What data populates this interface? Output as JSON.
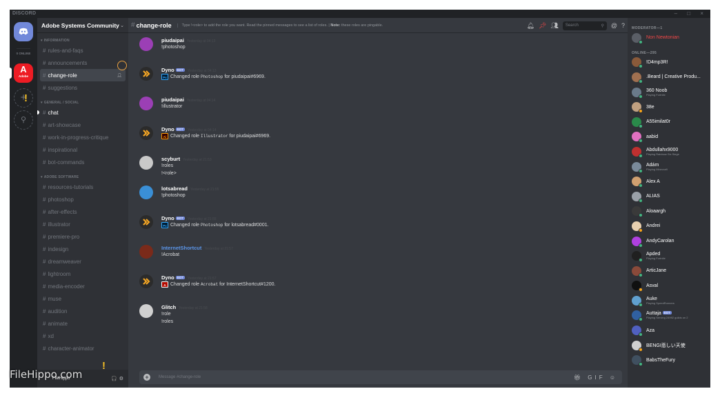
{
  "app": {
    "brand": "DISCORD",
    "window_controls": "– □ ×"
  },
  "guilds": {
    "online": "0 ONLINE",
    "adobe_logo": "A",
    "adobe_text": "Adobe",
    "add": "+",
    "search": "⚲"
  },
  "server": {
    "name": "Adobe Systems Community"
  },
  "categories": [
    {
      "label": "INFORMATION",
      "channels": [
        {
          "name": "rules-and-faqs",
          "state": "muted"
        },
        {
          "name": "announcements",
          "state": "muted"
        },
        {
          "name": "change-role",
          "state": "active"
        },
        {
          "name": "suggestions",
          "state": "muted"
        }
      ]
    },
    {
      "label": "GENERAL / SOCIAL",
      "channels": [
        {
          "name": "chat",
          "state": "unread"
        },
        {
          "name": "art-showcase",
          "state": "muted"
        },
        {
          "name": "work-in-progress-critique",
          "state": "muted"
        },
        {
          "name": "inspirational",
          "state": "muted"
        },
        {
          "name": "bot-commands",
          "state": "muted"
        }
      ]
    },
    {
      "label": "ADOBE SOFTWARE",
      "channels": [
        {
          "name": "resources-tutorials",
          "state": "muted"
        },
        {
          "name": "photoshop",
          "state": "muted"
        },
        {
          "name": "after-effects",
          "state": "muted"
        },
        {
          "name": "illustrator",
          "state": "muted"
        },
        {
          "name": "premiere-pro",
          "state": "muted"
        },
        {
          "name": "indesign",
          "state": "muted"
        },
        {
          "name": "dreamweaver",
          "state": "muted"
        },
        {
          "name": "lightroom",
          "state": "muted"
        },
        {
          "name": "media-encoder",
          "state": "muted"
        },
        {
          "name": "muse",
          "state": "muted"
        },
        {
          "name": "audition",
          "state": "muted"
        },
        {
          "name": "animate",
          "state": "muted"
        },
        {
          "name": "xd",
          "state": "muted"
        },
        {
          "name": "character-animator",
          "state": "muted"
        }
      ]
    }
  ],
  "userbar": {
    "name": "FileHippo"
  },
  "watermark": "FileHippo.com",
  "channel": {
    "name": "change-role",
    "topic_prefix": "Type !<role> to add the role you want. Read the pinned messages to see a list of roles. | ",
    "topic_note_label": "Note:",
    "topic_note": " these roles are pingable.",
    "search_placeholder": "Search"
  },
  "messages": [
    {
      "author": "piudaipai",
      "bot": false,
      "timestamp": "Yesterday at 04:13",
      "lines": [
        "!photoshop"
      ],
      "avatar_color": "#9b3fb5"
    },
    {
      "author": "Dyno",
      "bot": true,
      "timestamp": "Yesterday at 04:13",
      "app_icon": "Ps",
      "app_color": "#001e36",
      "app_fg": "#31a8ff",
      "pre": "Changed role ",
      "code": "Photoshop",
      "post": " for piudaipai#6969.",
      "avatar_color": "#f5a623"
    },
    {
      "author": "piudaipai",
      "bot": false,
      "timestamp": "Yesterday at 04:14",
      "lines": [
        "!illustrator"
      ],
      "avatar_color": "#9b3fb5"
    },
    {
      "author": "Dyno",
      "bot": true,
      "timestamp": "Yesterday at 04:14",
      "app_icon": "Ai",
      "app_color": "#330000",
      "app_fg": "#ff9a00",
      "pre": "Changed role ",
      "code": "Illustrator",
      "post": " for piudaipai#6969.",
      "avatar_color": "#f5a623"
    },
    {
      "author": "scyburt",
      "bot": false,
      "timestamp": "Yesterday at 21:53",
      "lines": [
        "!roles",
        "!<role>"
      ],
      "avatar_color": "#c9c9c9"
    },
    {
      "author": "lotsabread",
      "bot": false,
      "timestamp": "Yesterday at 21:55",
      "lines": [
        "!photoshop"
      ],
      "avatar_color": "#3a8fd6"
    },
    {
      "author": "Dyno",
      "bot": true,
      "timestamp": "Yesterday at 21:55",
      "app_icon": "Ps",
      "app_color": "#001e36",
      "app_fg": "#31a8ff",
      "pre": "Changed role ",
      "code": "Photoshop",
      "post": " for lotsabread#0001.",
      "avatar_color": "#f5a623"
    },
    {
      "author": "InternetShortcut",
      "bot": false,
      "blue": true,
      "timestamp": "Yesterday at 21:57",
      "lines": [
        "!Acrobat"
      ],
      "avatar_color": "#7a2a1a"
    },
    {
      "author": "Dyno",
      "bot": true,
      "timestamp": "Yesterday at 21:57",
      "app_icon": "A",
      "app_color": "#b30b00",
      "app_fg": "#ffffff",
      "pre": "Changed role ",
      "code": "Acrobat",
      "post": " for InternetShortcut#1200.",
      "avatar_color": "#f5a623"
    },
    {
      "author": "Glitch",
      "bot": false,
      "timestamp": "Yesterday at 21:58",
      "lines": [
        "!role",
        "!roles"
      ],
      "avatar_color": "#d0d0d0"
    }
  ],
  "composer": {
    "placeholder": "Message #change-role"
  },
  "members": {
    "moderator_label": "MODERATOR—1",
    "moderators": [
      {
        "name": "Non Newtonian",
        "color": "red",
        "avatar": "#5a5e66",
        "status": "#43b581"
      }
    ],
    "online_label": "ONLINE—295",
    "online": [
      {
        "name": "!D4mp3R!",
        "avatar": "#8a5a3a",
        "status": "#43b581"
      },
      {
        "name": ".Beard | Creative Produ...",
        "avatar": "#a07050",
        "status": "#43b581"
      },
      {
        "name": "360 Noob",
        "activity": "Playing Fortnite",
        "avatar": "#6a7a8a",
        "status": "#43b581"
      },
      {
        "name": "38e",
        "avatar": "#c0a080",
        "status": "#faa61a"
      },
      {
        "name": "A55imilat0r",
        "avatar": "#2a8a4a",
        "status": "#43b581"
      },
      {
        "name": "aabid",
        "avatar": "#e070c0",
        "status": "#43b581"
      },
      {
        "name": "Abdullahx9000",
        "activity": "Playing Rainbow Six Siege",
        "avatar": "#c03030",
        "status": "#43b581"
      },
      {
        "name": "Adám",
        "activity": "Playing Minecraft",
        "avatar": "#7a8a9a",
        "status": "#43b581"
      },
      {
        "name": "Alex A",
        "avatar": "#d0a070",
        "status": "#43b581"
      },
      {
        "name": "ALIAS",
        "avatar": "#9aa0a8",
        "status": "#43b581"
      },
      {
        "name": "Aloaargh",
        "avatar": "#3a3a3a",
        "status": "#43b581"
      },
      {
        "name": "Andrei",
        "avatar": "#e8d0b0",
        "status": "#faa61a"
      },
      {
        "name": "AndyCarolan",
        "avatar": "#b040e0",
        "status": "#43b581"
      },
      {
        "name": "Apded",
        "activity": "Playing Fortnite",
        "avatar": "#202020",
        "status": "#43b581"
      },
      {
        "name": "ArticJane",
        "avatar": "#8a4a3a",
        "status": "#43b581"
      },
      {
        "name": "Asval",
        "avatar": "#101010",
        "status": "#faa61a"
      },
      {
        "name": "Auke",
        "activity": "Playing SpeedRunners",
        "avatar": "#60a0d0",
        "status": "#43b581"
      },
      {
        "name": "Auttaja",
        "bot": "BOT",
        "activity": "Playing Serving 24992 guilds on 2",
        "avatar": "#3060a0",
        "status": "#43b581"
      },
      {
        "name": "Aza",
        "avatar": "#5060c0",
        "status": "#43b581"
      },
      {
        "name": "BENGI悲しい天使",
        "avatar": "#d0d0d0",
        "status": "#faa61a"
      },
      {
        "name": "BabsTheFury",
        "avatar": "#405060",
        "status": "#43b581"
      }
    ]
  },
  "colors": {
    "bg": "#36393f",
    "sidebar": "#2f3136",
    "guildbar": "#202225",
    "blurple": "#7289da",
    "online": "#43b581",
    "idle": "#faa61a"
  }
}
